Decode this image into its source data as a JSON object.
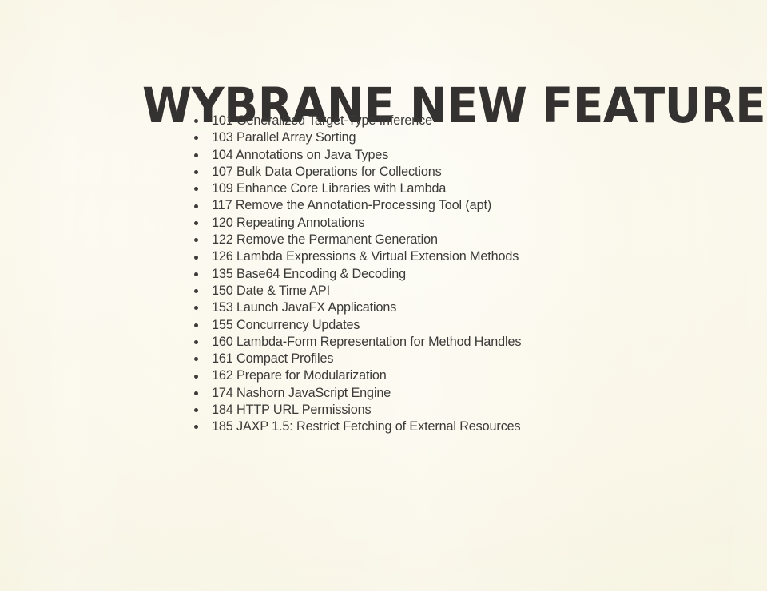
{
  "slide": {
    "title": "WYBRANE NEW FEATURES",
    "background_color": "#f4f1da",
    "background_center_color": "#fdfcf6",
    "title_color": "#333230",
    "text_color": "#3a3a38",
    "bullet_color": "#3d3c39",
    "bullet_glyph": "bullet-dot"
  },
  "features": [
    {
      "label": "101 Generalized Target-Type Inference"
    },
    {
      "label": "103 Parallel Array Sorting"
    },
    {
      "label": "104 Annotations on Java Types"
    },
    {
      "label": "107 Bulk Data Operations for Collections"
    },
    {
      "label": "109 Enhance Core Libraries with Lambda"
    },
    {
      "label": "117 Remove the Annotation-Processing Tool (apt)"
    },
    {
      "label": "120 Repeating Annotations"
    },
    {
      "label": "122 Remove the Permanent Generation"
    },
    {
      "label": "126 Lambda Expressions & Virtual Extension Methods"
    },
    {
      "label": "135 Base64 Encoding & Decoding"
    },
    {
      "label": "150 Date & Time API"
    },
    {
      "label": "153 Launch JavaFX Applications"
    },
    {
      "label": "155 Concurrency Updates"
    },
    {
      "label": "160 Lambda-Form Representation for Method Handles"
    },
    {
      "label": "161 Compact Profiles"
    },
    {
      "label": "162 Prepare for Modularization"
    },
    {
      "label": "174 Nashorn JavaScript Engine"
    },
    {
      "label": "184 HTTP URL Permissions"
    },
    {
      "label": "185 JAXP 1.5: Restrict Fetching of External Resources"
    }
  ]
}
